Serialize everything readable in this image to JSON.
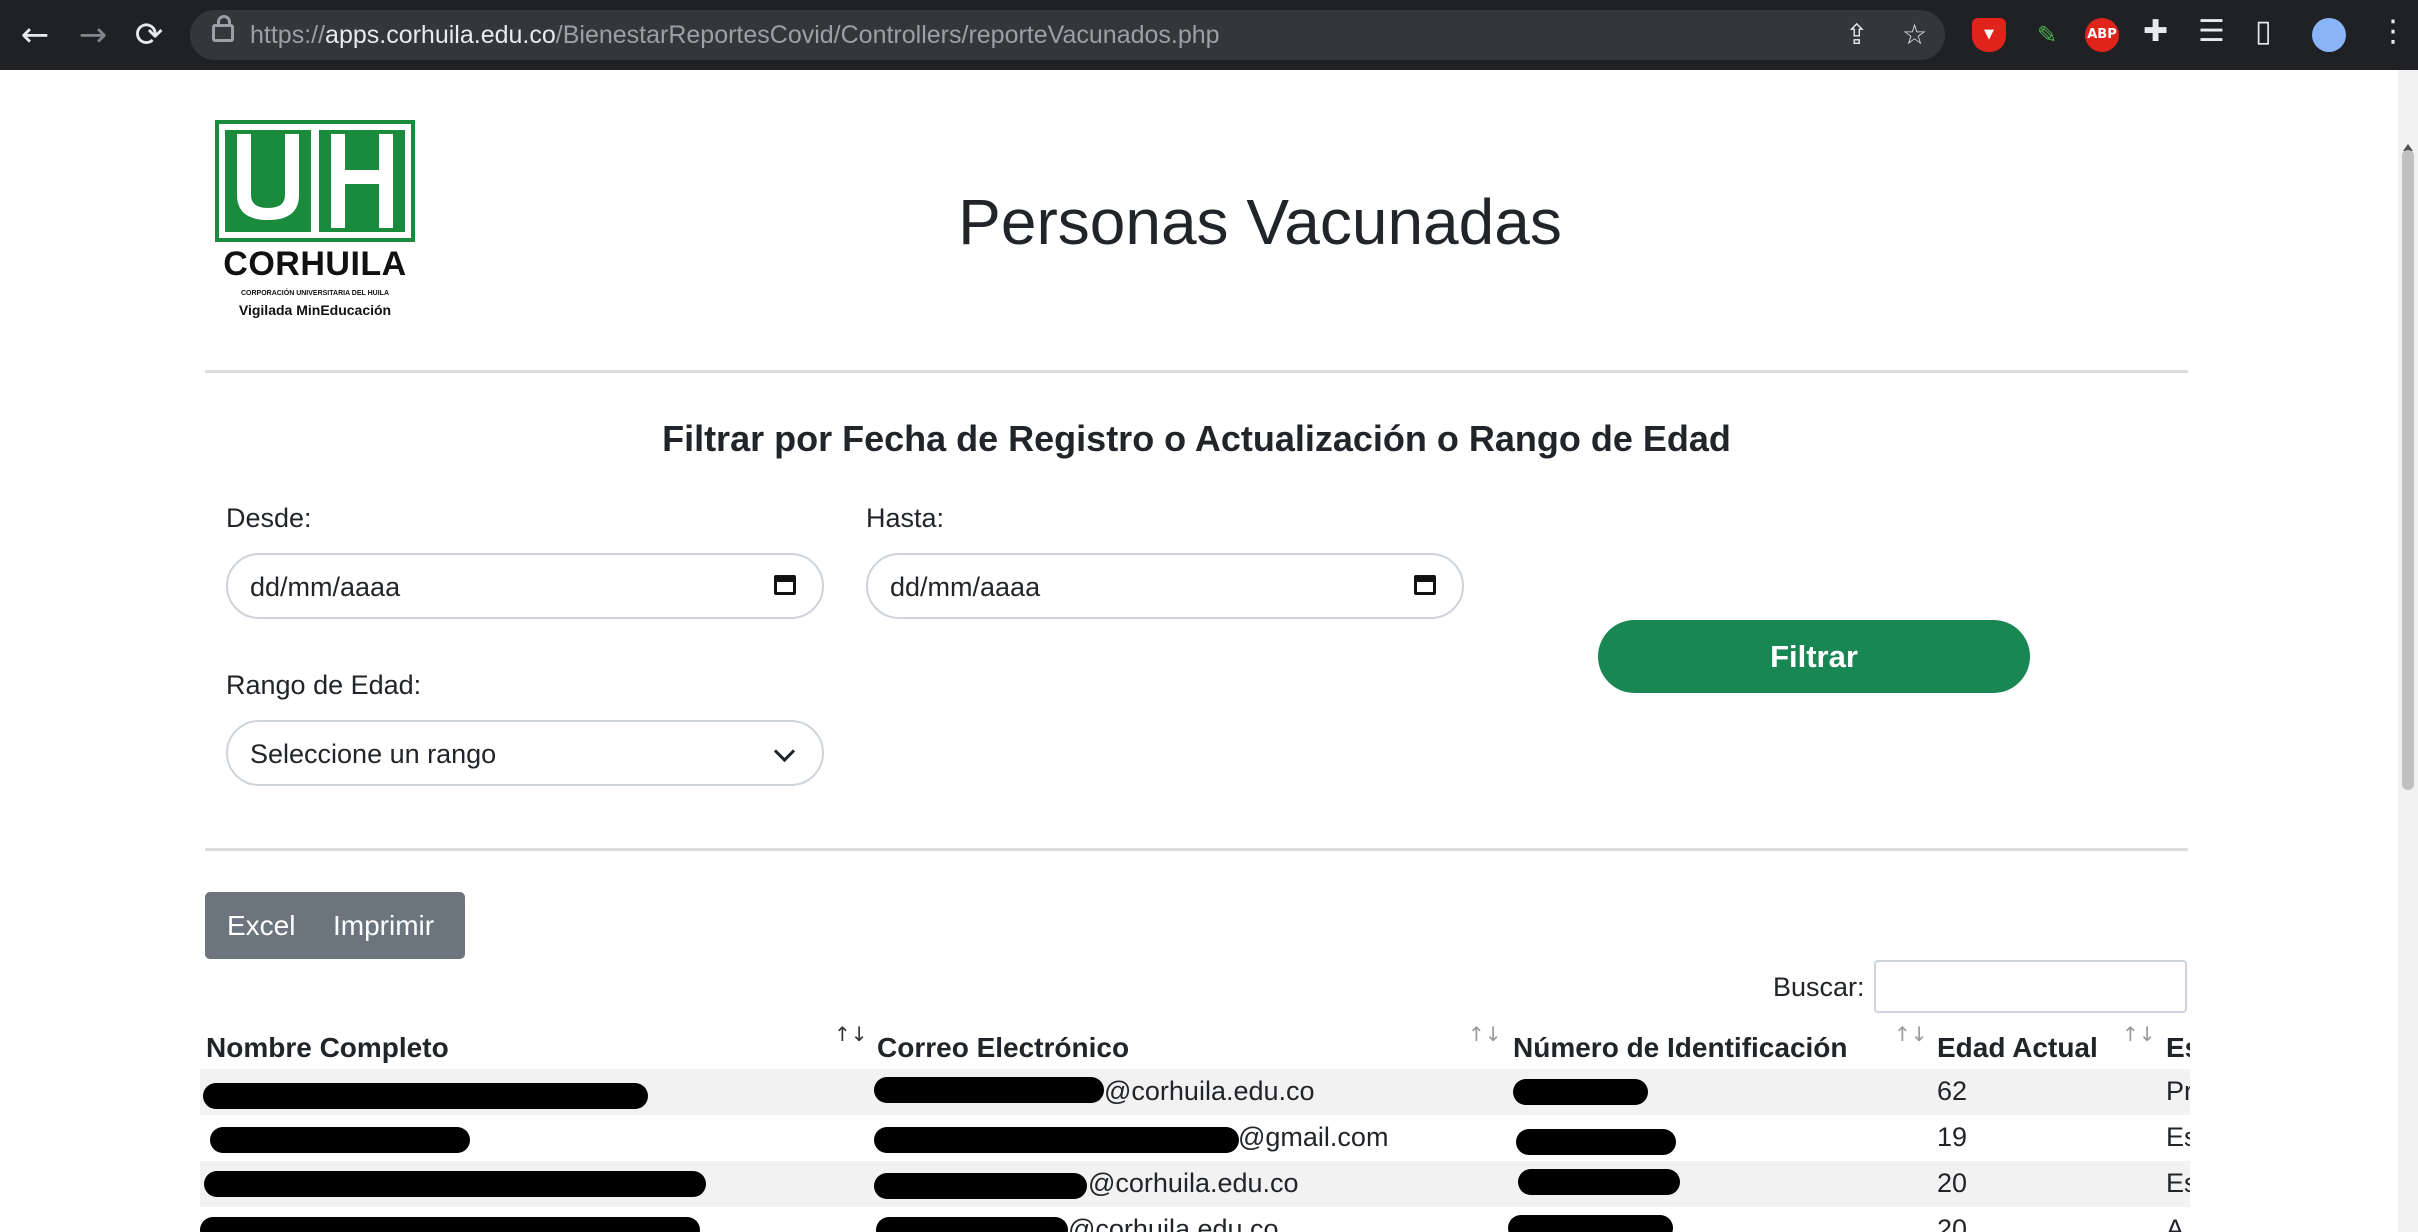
{
  "browser": {
    "url_scheme": "https://",
    "url_host": "apps.corhuila.edu.co",
    "url_path": "/BienestarReportesCovid/Controllers/reporteVacunados.php",
    "ext_abp": "ABP"
  },
  "logo": {
    "name": "CORHUILA",
    "subtitle": "CORPORACIÓN UNIVERSITARIA DEL HUILA",
    "tagline": "Vigilada MinEducación",
    "color": "#1a8a3c"
  },
  "page": {
    "title": "Personas Vacunadas",
    "filter_title": "Filtrar por Fecha de Registro o Actualización o Rango de Edad"
  },
  "filters": {
    "desde_label": "Desde:",
    "desde_value": "dd/mm/aaaa",
    "hasta_label": "Hasta:",
    "hasta_value": "dd/mm/aaaa",
    "rango_label": "Rango de Edad:",
    "rango_value": "Seleccione un rango",
    "filtrar_label": "Filtrar"
  },
  "toolbar": {
    "excel_label": "Excel",
    "imprimir_label": "Imprimir",
    "search_label": "Buscar:"
  },
  "table": {
    "headers": [
      "Nombre Completo",
      "Correo Electrónico",
      "Número de Identificación",
      "Edad Actual",
      "Es"
    ],
    "rows": [
      {
        "email_suffix": "@corhuila.edu.co",
        "edad": "62",
        "estado": "Pr"
      },
      {
        "email_suffix": "@gmail.com",
        "edad": "19",
        "estado": "Es"
      },
      {
        "email_suffix": "@corhuila.edu.co",
        "edad": "20",
        "estado": "Es"
      },
      {
        "email_suffix": "@corhuila.edu.co",
        "edad": "20",
        "estado": "A"
      }
    ]
  },
  "colors": {
    "accent": "#198754",
    "secondary": "#6c757d"
  }
}
